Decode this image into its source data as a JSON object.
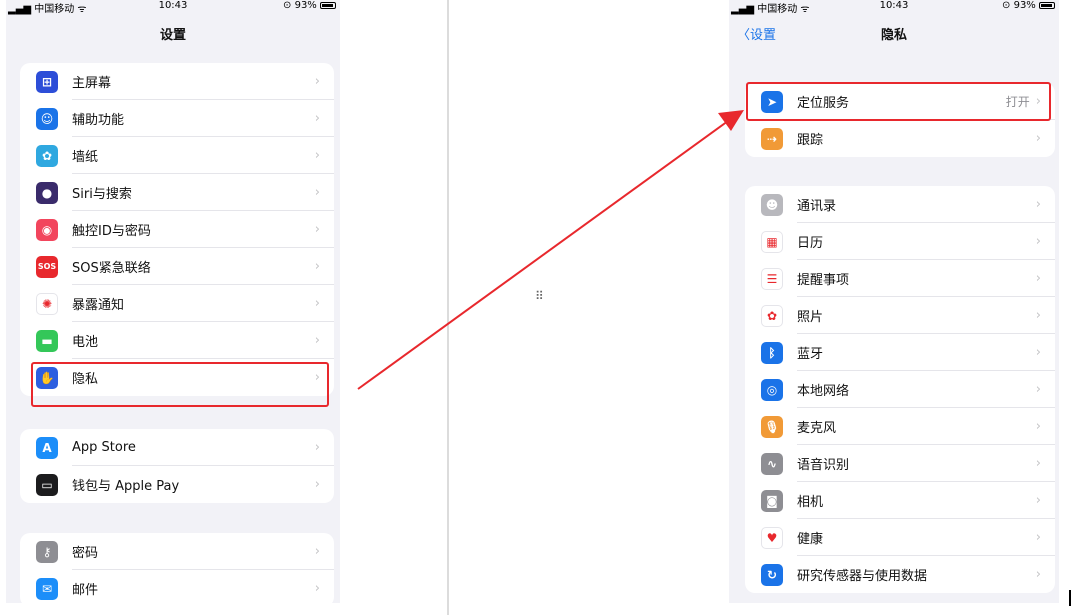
{
  "status_bar": {
    "carrier": "中国移动",
    "time": "10:43",
    "battery": "93%"
  },
  "left": {
    "title": "设置",
    "group1": [
      {
        "label": "主屏幕",
        "icon": "home-screen-icon",
        "color": "#2d4ed8",
        "glyph": "⊞"
      },
      {
        "label": "辅助功能",
        "icon": "accessibility-icon",
        "color": "#1a73e8",
        "glyph": "☺"
      },
      {
        "label": "墙纸",
        "icon": "wallpaper-icon",
        "color": "#2fa8e0",
        "glyph": "✿"
      },
      {
        "label": "Siri与搜索",
        "icon": "siri-icon",
        "color": "#3a2b6b",
        "glyph": "●"
      },
      {
        "label": "触控ID与密码",
        "icon": "touch-id-icon",
        "color": "#f2455d",
        "glyph": "◉"
      },
      {
        "label": "SOS紧急联络",
        "icon": "sos-icon",
        "color": "#e8282d",
        "glyph": "SOS"
      },
      {
        "label": "暴露通知",
        "icon": "exposure-icon",
        "color": "#ffffff",
        "glyph": "✺"
      },
      {
        "label": "电池",
        "icon": "battery-icon",
        "color": "#34c759",
        "glyph": "▬"
      },
      {
        "label": "隐私",
        "icon": "privacy-hand-icon",
        "color": "#2d5fe0",
        "glyph": "✋"
      }
    ],
    "group2": [
      {
        "label": "App Store",
        "icon": "app-store-icon",
        "color": "#1c8ef9",
        "glyph": "A"
      },
      {
        "label": "钱包与 Apple Pay",
        "icon": "wallet-icon",
        "color": "#1c1c1e",
        "glyph": "▭"
      }
    ],
    "group3": [
      {
        "label": "密码",
        "icon": "key-icon",
        "color": "#8e8e93",
        "glyph": "⚷"
      },
      {
        "label": "邮件",
        "icon": "mail-icon",
        "color": "#1c8ef9",
        "glyph": "✉"
      }
    ]
  },
  "right": {
    "back_label": "设置",
    "title": "隐私",
    "group1": [
      {
        "label": "定位服务",
        "value": "打开",
        "icon": "location-icon",
        "color": "#1a73e8",
        "glyph": "➤"
      },
      {
        "label": "跟踪",
        "value": "",
        "icon": "tracking-icon",
        "color": "#f19a37",
        "glyph": "⇢"
      }
    ],
    "group2": [
      {
        "label": "通讯录",
        "icon": "contacts-icon",
        "color": "#b8b8bd",
        "glyph": "☻"
      },
      {
        "label": "日历",
        "icon": "calendar-icon",
        "color": "#ffffff",
        "glyph": "▦"
      },
      {
        "label": "提醒事项",
        "icon": "reminders-icon",
        "color": "#ffffff",
        "glyph": "☰"
      },
      {
        "label": "照片",
        "icon": "photos-icon",
        "color": "#ffffff",
        "glyph": "✿"
      },
      {
        "label": "蓝牙",
        "icon": "bluetooth-icon",
        "color": "#1a73e8",
        "glyph": "ᛒ"
      },
      {
        "label": "本地网络",
        "icon": "local-network-icon",
        "color": "#1a73e8",
        "glyph": "◎"
      },
      {
        "label": "麦克风",
        "icon": "microphone-icon",
        "color": "#f19a37",
        "glyph": "🎙"
      },
      {
        "label": "语音识别",
        "icon": "speech-recognition-icon",
        "color": "#8e8e93",
        "glyph": "∿"
      },
      {
        "label": "相机",
        "icon": "camera-icon",
        "color": "#8e8e93",
        "glyph": "◙"
      },
      {
        "label": "健康",
        "icon": "health-icon",
        "color": "#ffffff",
        "glyph": "♥"
      },
      {
        "label": "研究传感器与使用数据",
        "icon": "research-sensor-icon",
        "color": "#1a73e8",
        "glyph": "↻"
      }
    ]
  },
  "chevron": "›"
}
